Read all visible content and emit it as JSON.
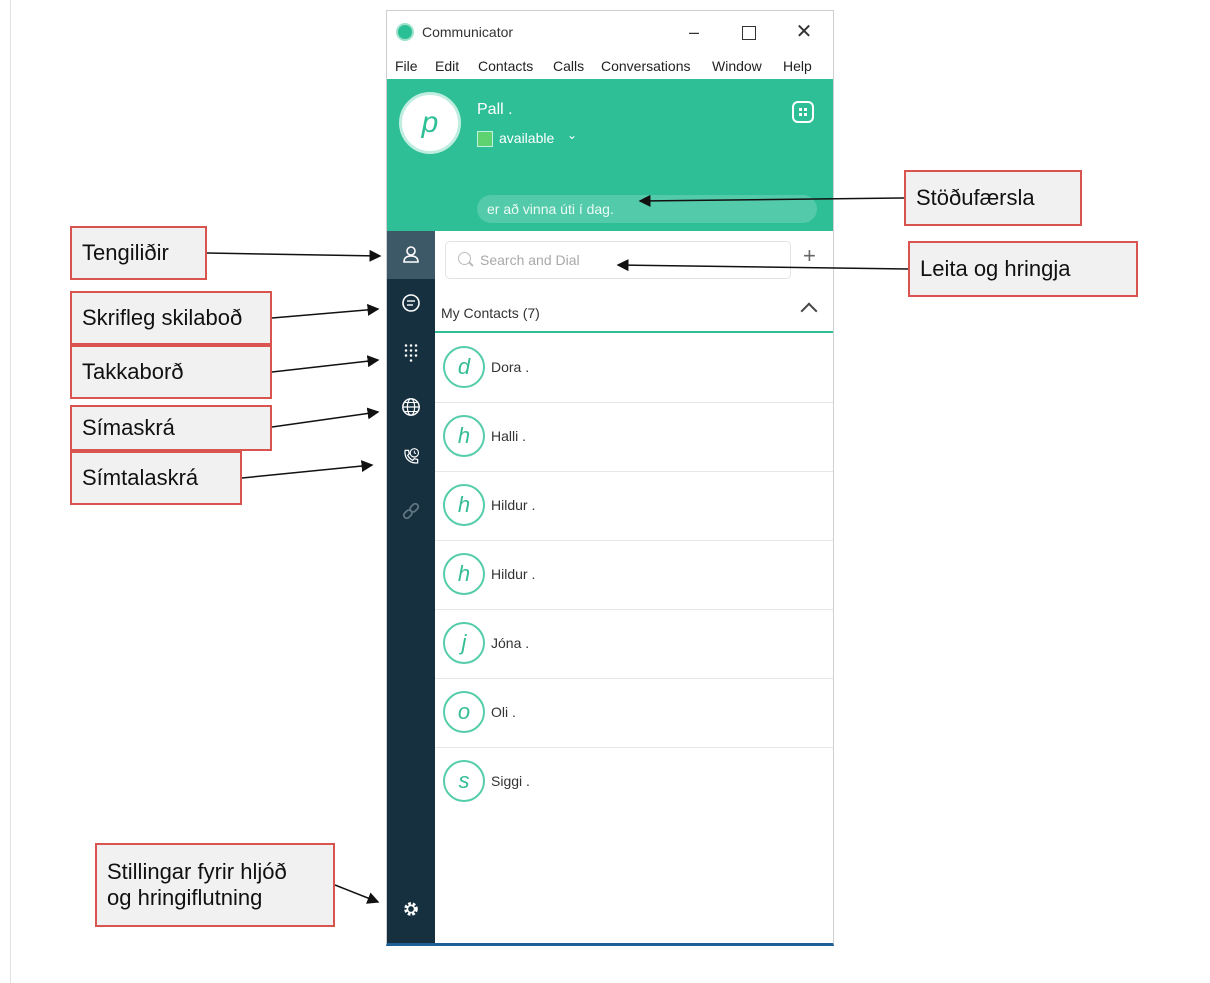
{
  "window": {
    "title": "Communicator",
    "controls": {
      "minimize": "–",
      "maximize": "",
      "close": "✕"
    }
  },
  "menu": [
    "File",
    "Edit",
    "Contacts",
    "Calls",
    "Conversations",
    "Window",
    "Help"
  ],
  "profile": {
    "avatar_letter": "p",
    "name": "Pall .",
    "status": "available",
    "status_chevron": "⌄",
    "status_message": "er að vinna úti í dag.",
    "status_color": "#5fd36f"
  },
  "nav": [
    {
      "icon": "contacts-icon",
      "active": true
    },
    {
      "icon": "chat-icon"
    },
    {
      "icon": "dialpad-icon"
    },
    {
      "icon": "globe-icon"
    },
    {
      "icon": "call-history-icon"
    },
    {
      "icon": "link-icon"
    },
    {
      "icon": "gear-icon"
    }
  ],
  "search": {
    "placeholder": "Search and Dial",
    "add_label": "+"
  },
  "group": {
    "title": "My Contacts (7)"
  },
  "contacts": [
    {
      "letter": "d",
      "name": "Dora ."
    },
    {
      "letter": "h",
      "name": "Halli ."
    },
    {
      "letter": "h",
      "name": "Hildur ."
    },
    {
      "letter": "h",
      "name": "Hildur ."
    },
    {
      "letter": "j",
      "name": "Jóna ."
    },
    {
      "letter": "o",
      "name": "Oli ."
    },
    {
      "letter": "s",
      "name": "Siggi ."
    }
  ],
  "annotations": {
    "status_post": "Stöðufærsla",
    "search_and_dial": "Leita og hringja",
    "contacts": "Tengiliðir",
    "messages": "Skrifleg skilaboð",
    "keypad": "Takkaborð",
    "directory": "Símaskrá",
    "call_log": "Símtalaskrá",
    "settings_line1": "Stillingar fyrir hljóð",
    "settings_line2": "og hringiflutning"
  },
  "colors": {
    "accent": "#2ebf96",
    "sidebar": "#17303f",
    "sidebar_active": "#3d5866",
    "annotation_border": "#d9534f"
  }
}
